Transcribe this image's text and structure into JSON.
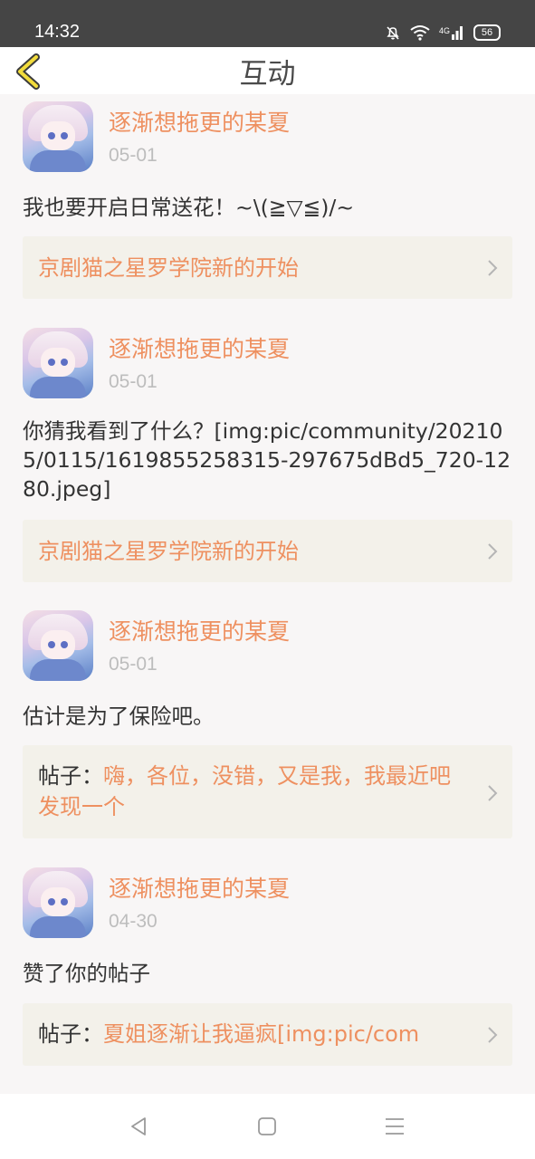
{
  "status_bar": {
    "time": "14:32",
    "network": "4G",
    "battery": "56"
  },
  "header": {
    "title": "互动"
  },
  "items": [
    {
      "username": "逐渐想拖更的某夏",
      "date": "05-01",
      "message": "我也要开启日常送花！~\\(≧▽≦)/~",
      "ref_prefix": "",
      "ref_text": "京剧猫之星罗学院新的开始"
    },
    {
      "username": "逐渐想拖更的某夏",
      "date": "05-01",
      "message": "你猜我看到了什么？[img:pic/community/202105/0115/1619855258315-297675dBd5_720-1280.jpeg]",
      "ref_prefix": "",
      "ref_text": "京剧猫之星罗学院新的开始"
    },
    {
      "username": "逐渐想拖更的某夏",
      "date": "05-01",
      "message": "估计是为了保险吧。",
      "ref_prefix": "帖子：",
      "ref_text": "嗨，各位，没错，又是我，我最近吧发现一个"
    },
    {
      "username": "逐渐想拖更的某夏",
      "date": "04-30",
      "message": "赞了你的帖子",
      "ref_prefix": "帖子：",
      "ref_text": "夏姐逐渐让我逼疯[img:pic/com"
    }
  ]
}
